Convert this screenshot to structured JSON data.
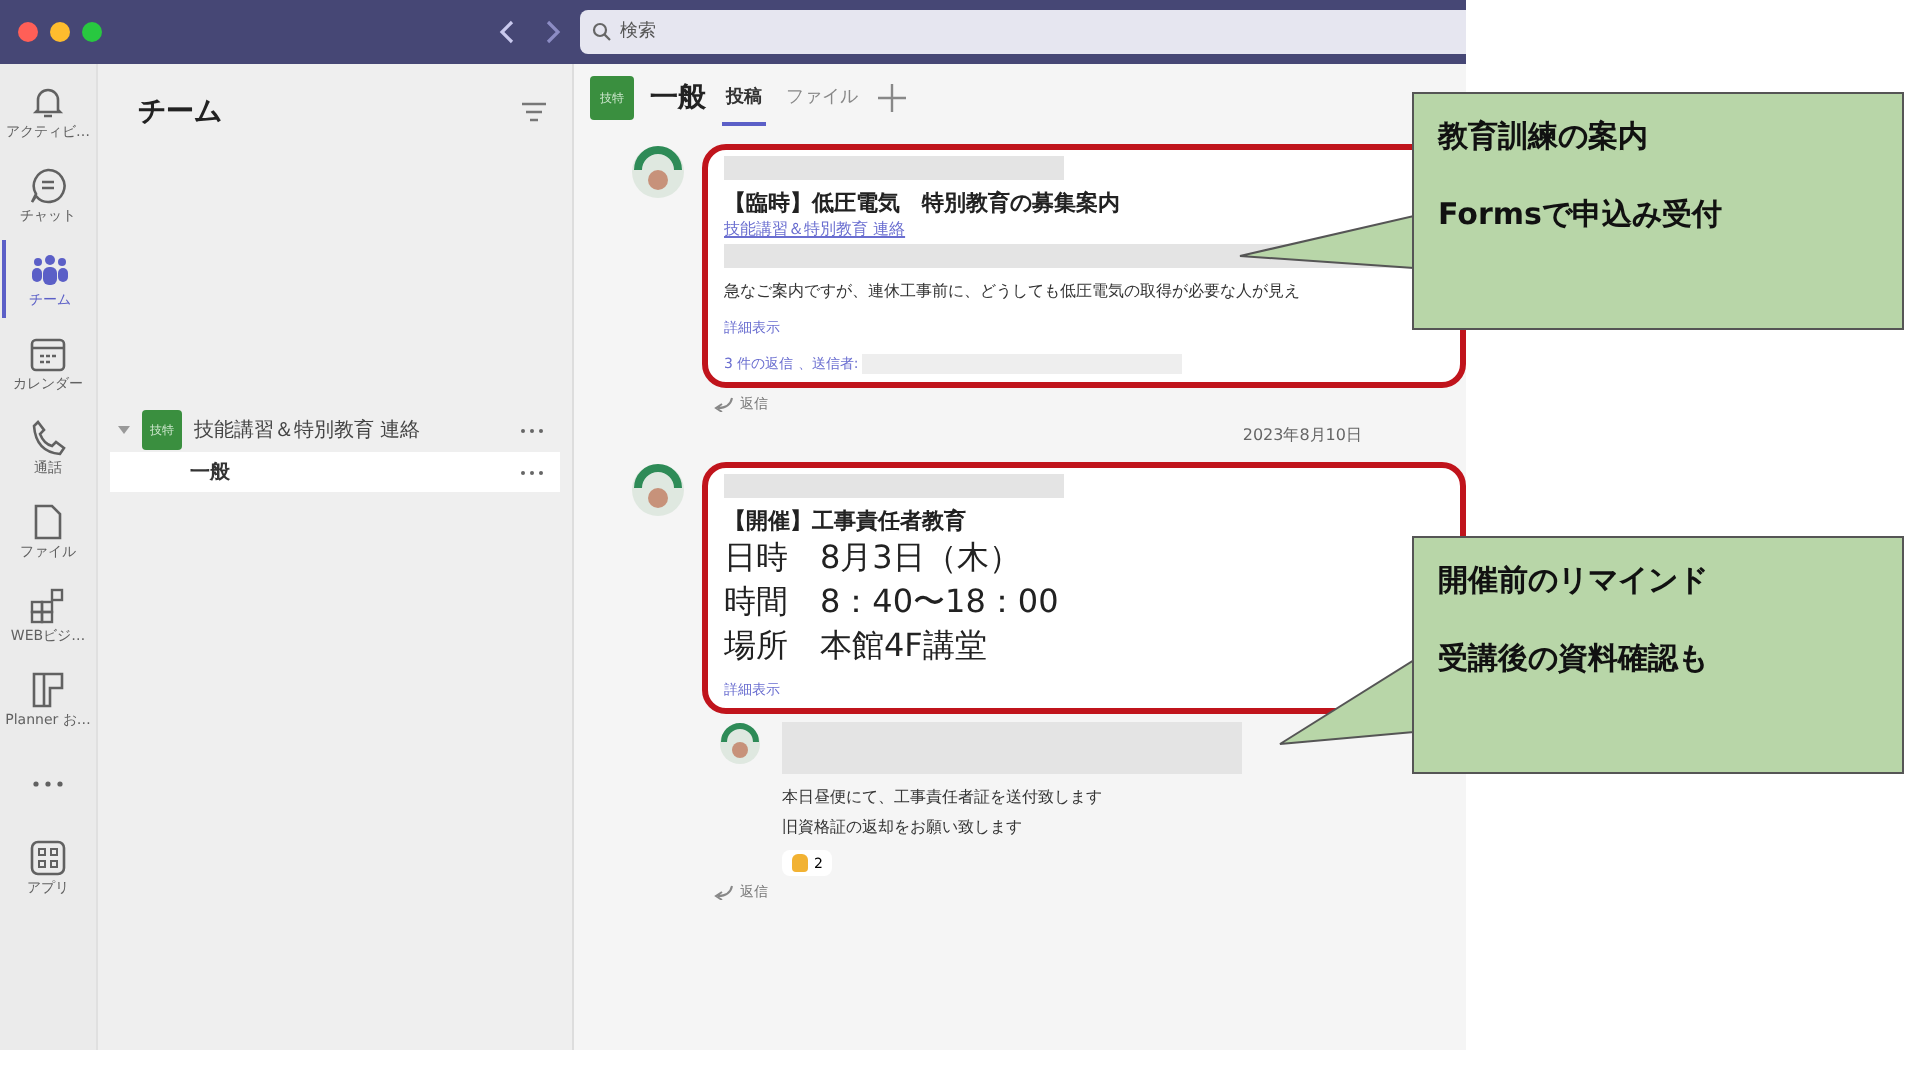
{
  "search": {
    "placeholder": "検索"
  },
  "rail": [
    {
      "kind": "bell",
      "label": "アクティビ…",
      "selected": false
    },
    {
      "kind": "chat",
      "label": "チャット",
      "selected": false
    },
    {
      "kind": "teams",
      "label": "チーム",
      "selected": true
    },
    {
      "kind": "calendar",
      "label": "カレンダー",
      "selected": false
    },
    {
      "kind": "call",
      "label": "通話",
      "selected": false
    },
    {
      "kind": "file",
      "label": "ファイル",
      "selected": false
    },
    {
      "kind": "apps",
      "label": "WEBビジ…",
      "selected": false
    },
    {
      "kind": "planner",
      "label": "Planner お…",
      "selected": false
    },
    {
      "kind": "more",
      "selected": false
    },
    {
      "kind": "grid",
      "label": "アプリ",
      "selected": false
    }
  ],
  "teams_panel": {
    "title": "チーム",
    "teams": [
      {
        "badge": "技特",
        "name": "技能講習＆特別教育 連絡",
        "expanded": true,
        "channels": [
          {
            "name": "一般",
            "selected": true
          }
        ]
      }
    ]
  },
  "channel": {
    "badge": "技特",
    "name": "一般",
    "tabs": [
      {
        "label": "投稿",
        "selected": true
      },
      {
        "label": "ファイル",
        "selected": false
      }
    ]
  },
  "posts": [
    {
      "highlighted": true,
      "title": "【臨時】低圧電気　特別教育の募集案内",
      "team_link": "技能講習＆特別教育 連絡",
      "body": [
        "急なご案内ですが、連休工事前に、どうしても低圧電気の取得が必要な人が見え"
      ],
      "more": "詳細表示",
      "replies_summary": "3 件の返信 、送信者:",
      "reply": "返信"
    },
    {
      "date": "2023年8月10日",
      "highlighted": true,
      "title": "【開催】工事責任者教育",
      "large_lines": [
        "日時　8月3日（木）",
        "時間　8：40〜18：00",
        "場所　本館4F講堂"
      ],
      "more": "詳細表示",
      "thread": [
        {
          "body": [
            "本日昼便にて、工事責任者証を送付致します",
            "旧資格証の返却をお願い致します"
          ],
          "reaction_count": "2"
        }
      ],
      "reply": "返信"
    }
  ],
  "callouts": [
    {
      "title": "教育訓練の案内",
      "note": "Formsで申込み受付"
    },
    {
      "title": "開催前のリマインド",
      "note": "受講後の資料確認も"
    }
  ]
}
